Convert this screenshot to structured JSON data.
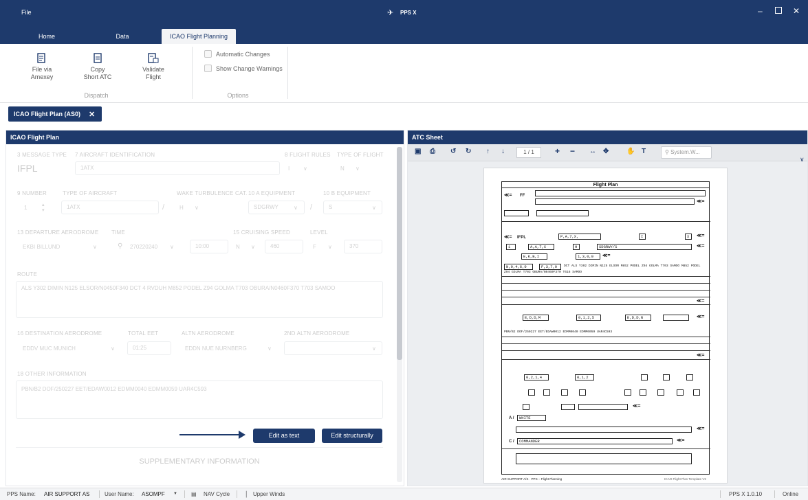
{
  "titlebar": {
    "menu_file": "File",
    "app_name": "PPS X"
  },
  "tabs": [
    "Home",
    "Data",
    "ICAO Flight Planning"
  ],
  "ribbon": {
    "dispatch": {
      "buttons": [
        {
          "line1": "File via",
          "line2": "Amexey"
        },
        {
          "line1": "Copy",
          "line2": "Short ATC"
        },
        {
          "line1": "Validate",
          "line2": "Flight"
        }
      ],
      "label": "Dispatch"
    },
    "options": {
      "checks": [
        "Automatic Changes",
        "Show Change Warnings"
      ],
      "label": "Options"
    }
  },
  "doc_tab": "ICAO Flight Plan (AS0)",
  "left_panel": {
    "title": "ICAO Flight Plan",
    "labels": {
      "msg_type": "3 MESSAGE TYPE",
      "aircraft_id": "7 AIRCRAFT IDENTIFICATION",
      "flight_rules": "8 FLIGHT RULES",
      "type_of_flight": "TYPE OF FLIGHT",
      "number": "9 NUMBER",
      "type_aircraft": "TYPE OF AIRCRAFT",
      "wake": "WAKE TURBULENCE CAT.",
      "equip10a": "10 A EQUIPMENT",
      "equip10b": "10 B EQUIPMENT",
      "departure": "13 DEPARTURE AERODROME",
      "time": "TIME",
      "cruising": "15 CRUISING SPEED",
      "level": "LEVEL",
      "route": "ROUTE",
      "destination": "16 DESTINATION AERODROME",
      "total_eet": "TOTAL EET",
      "altn": "ALTN AERODROME",
      "altn2": "2ND ALTN AERODROME",
      "other": "18 OTHER INFORMATION"
    },
    "values": {
      "msg_type": "IFPL",
      "aircraft_id": "1ATX",
      "flight_rules": "I",
      "type_of_flight": "N",
      "number": "1",
      "type_aircraft": "1ATX",
      "wake": "H",
      "equip10a": "SDGRWY",
      "equip10b": "S",
      "departure": "EKBI BILLUND",
      "time": "270220240",
      "time2": "10:00",
      "cruising_unit": "N",
      "cruising": "460",
      "level_unit": "F",
      "level": "370",
      "route": "ALS Y302 DIMIN N125 ELSOR/N0450F340 DCT 4 RVDUH M852 PODEL Z94 GOLMA T703 OBURA/N0460F370 T703 SAMOO",
      "destination": "EDDV MUC MUNICH",
      "total_eet": "01:25",
      "altn": "EDDN NUE NURNBERG",
      "other": "PBN/B2 DOF/250227 EET/EDAW0012 EDMM0040 EDMM0059 UAR4C593"
    },
    "buttons": {
      "edit_text": "Edit as text",
      "edit_struct": "Edit structurally"
    },
    "supplementary": "SUPPLEMENTARY INFORMATION"
  },
  "right_panel": {
    "title": "ATC Sheet",
    "page": "1 / 1",
    "search_placeholder": "System.W...",
    "form": {
      "title": "Flight Plan",
      "priority": "FF",
      "msg": "IFPL",
      "acid": "P,A,7,X,",
      "rules": "I",
      "type": "X",
      "num": "1",
      "actype": "A,A,7,X",
      "wake": "H",
      "equip": "SDGRWY/S",
      "dep": "E,K,B,I",
      "time": "1,3,0,0",
      "speed": "N,0,4,6,0",
      "level": "F,3,7,0",
      "route_line1": "DCT ALS Y302 DIMIN N125 ELSOR M852 PODEL Z94 GOLMA T703 SAMOO M852 PODEL",
      "route_line2": "Z94 GOLMA T703 OBURA/N0460F370 T616 SAMOO",
      "dest": "E,D,D,M",
      "eet": "0,1,2,5",
      "altn": "E,D,D,N",
      "other": "PBN/B2 DOF/250227 EET/EDAW0012 EDMM0040 EDMM0059 UAR4C593",
      "endurance": "0,2,1,4",
      "persons": "0,1,2",
      "acft_color": "WHITE",
      "pilot": "COMMANDER",
      "footer_left": "AIR SUPPORT A/S · PPS – Flight Planning",
      "footer_right": "ICAO Flight Plan Template V2"
    }
  },
  "status": {
    "pps_name_label": "PPS Name:",
    "pps_name": "AIR SUPPORT AS",
    "user_label": "User Name:",
    "user": "ASOMPF",
    "nav": "NAV Cycle",
    "winds": "Upper Winds",
    "version": "PPS X 1.0.10",
    "online": "Online"
  }
}
